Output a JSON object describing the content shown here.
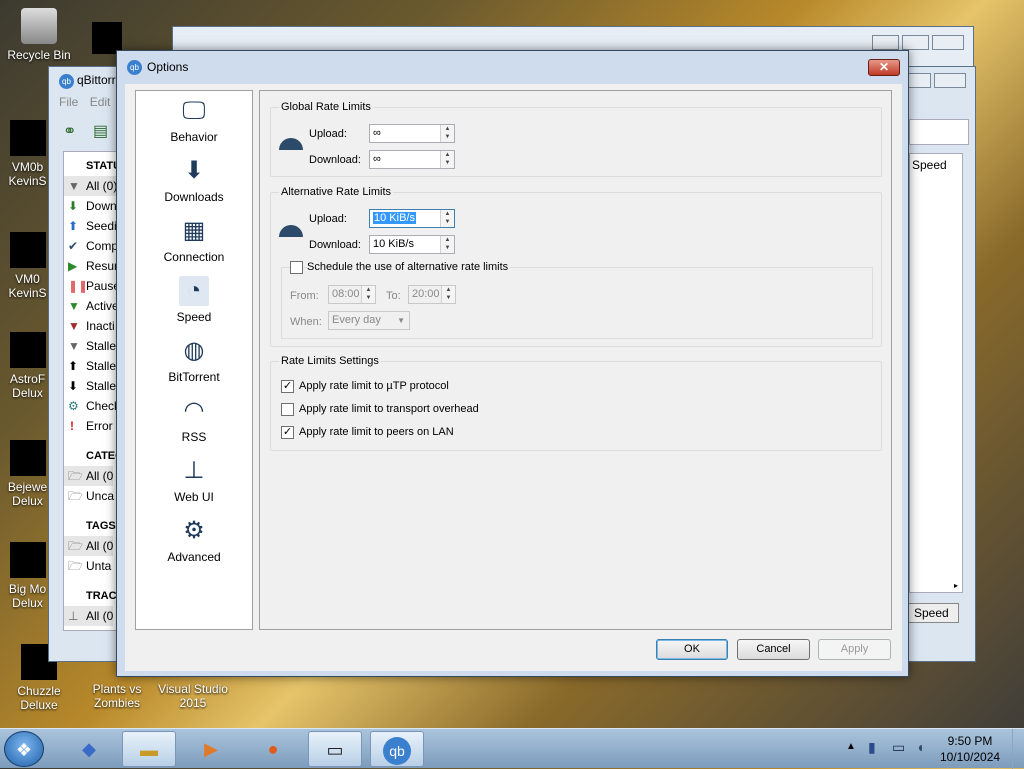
{
  "desktop": {
    "icons": [
      "Recycle Bin",
      "VM0b KevinS",
      "VM0 KevinS",
      "AstroF Delux",
      "Bejewe Delux",
      "Big Mo Delux",
      "Chuzzle Deluxe",
      "Plants vs Zombies",
      "Visual Studio 2015"
    ]
  },
  "bg_window": {
    "title": "qBittorr",
    "menu": [
      "File",
      "Edit"
    ],
    "status_header": "STATU",
    "status_items": [
      "All (0)",
      "Down",
      "Seedi",
      "Comp",
      "Resur",
      "Pause",
      "Active",
      "Inacti",
      "Stalle",
      "Stalle",
      "Stalle",
      "Check",
      "Error"
    ],
    "categories_header": "CATEG",
    "categories_items": [
      "All (0",
      "Unca"
    ],
    "tags_header": "TAGS",
    "tags_items": [
      "All (0",
      "Unta"
    ],
    "trackers_header": "TRACK",
    "trackers_items": [
      "All (0"
    ],
    "speed_col": "Speed",
    "speed_btn": "Speed"
  },
  "dialog": {
    "title": "Options",
    "close_icon": "close-icon",
    "nav": [
      {
        "label": "Behavior",
        "icon": "monitor-gear-icon"
      },
      {
        "label": "Downloads",
        "icon": "download-icon"
      },
      {
        "label": "Connection",
        "icon": "network-icon"
      },
      {
        "label": "Speed",
        "icon": "speedometer-icon"
      },
      {
        "label": "BitTorrent",
        "icon": "globe-gear-icon"
      },
      {
        "label": "RSS",
        "icon": "rss-icon"
      },
      {
        "label": "Web UI",
        "icon": "web-ui-icon"
      },
      {
        "label": "Advanced",
        "icon": "gears-icon"
      }
    ],
    "global": {
      "title": "Global Rate Limits",
      "upload_label": "Upload:",
      "upload_value": "∞",
      "download_label": "Download:",
      "download_value": "∞"
    },
    "alternative": {
      "title": "Alternative Rate Limits",
      "upload_label": "Upload:",
      "upload_value": "10 KiB/s",
      "download_label": "Download:",
      "download_value": "10 KiB/s",
      "schedule_label": "Schedule the use of alternative rate limits",
      "schedule_checked": false,
      "from_label": "From:",
      "from_value": "08:00",
      "to_label": "To:",
      "to_value": "20:00",
      "when_label": "When:",
      "when_value": "Every day"
    },
    "settings": {
      "title": "Rate Limits Settings",
      "options": [
        {
          "label": "Apply rate limit to µTP protocol",
          "checked": true
        },
        {
          "label": "Apply rate limit to transport overhead",
          "checked": false
        },
        {
          "label": "Apply rate limit to peers on LAN",
          "checked": true
        }
      ]
    },
    "buttons": {
      "ok": "OK",
      "cancel": "Cancel",
      "apply": "Apply"
    }
  },
  "taskbar": {
    "time": "9:50 PM",
    "date": "10/10/2024"
  }
}
